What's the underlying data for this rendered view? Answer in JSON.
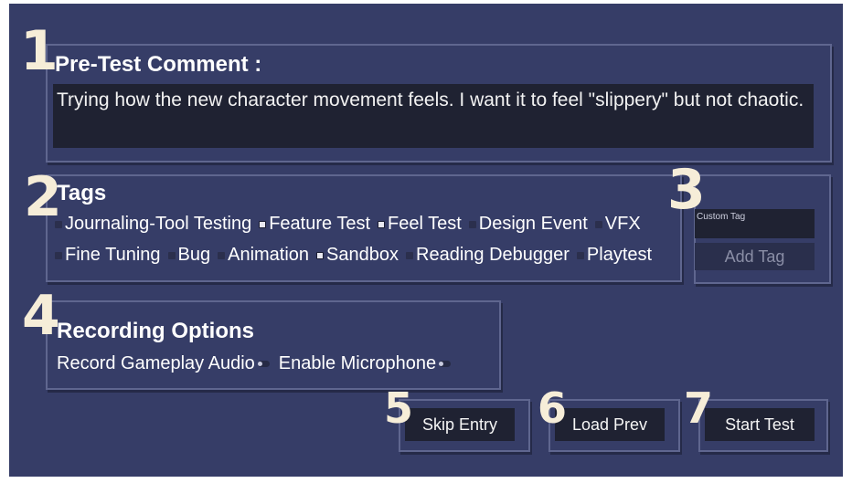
{
  "markers": [
    "1",
    "2",
    "3",
    "4",
    "5",
    "6",
    "7"
  ],
  "pre_test": {
    "title": "Pre-Test Comment :",
    "text": "Trying how the new character movement feels. I want it to feel \"slippery\" but not chaotic."
  },
  "tags": {
    "title": "Tags",
    "row1": [
      {
        "label": "Journaling-Tool Testing",
        "checked": false
      },
      {
        "label": "Feature Test",
        "checked": true
      },
      {
        "label": "Feel Test",
        "checked": true
      },
      {
        "label": "Design Event",
        "checked": false
      },
      {
        "label": "VFX",
        "checked": false
      }
    ],
    "row2": [
      {
        "label": "Fine Tuning",
        "checked": false
      },
      {
        "label": "Bug",
        "checked": false
      },
      {
        "label": "Animation",
        "checked": false
      },
      {
        "label": "Sandbox",
        "checked": true
      },
      {
        "label": "Reading Debugger",
        "checked": false
      },
      {
        "label": "Playtest",
        "checked": false
      }
    ]
  },
  "custom_tag": {
    "placeholder": "Custom Tag",
    "add_label": "Add Tag"
  },
  "recording": {
    "title": "Recording Options",
    "options": [
      {
        "label": "Record Gameplay Audio",
        "enabled": false
      },
      {
        "label": "Enable Microphone",
        "enabled": false
      }
    ]
  },
  "actions": {
    "skip": "Skip Entry",
    "load": "Load Prev",
    "start": "Start Test"
  },
  "colors": {
    "background": "#363d67",
    "panel_border": "#5f668f",
    "field": "#1f2232",
    "marker": "#f6edd8"
  }
}
